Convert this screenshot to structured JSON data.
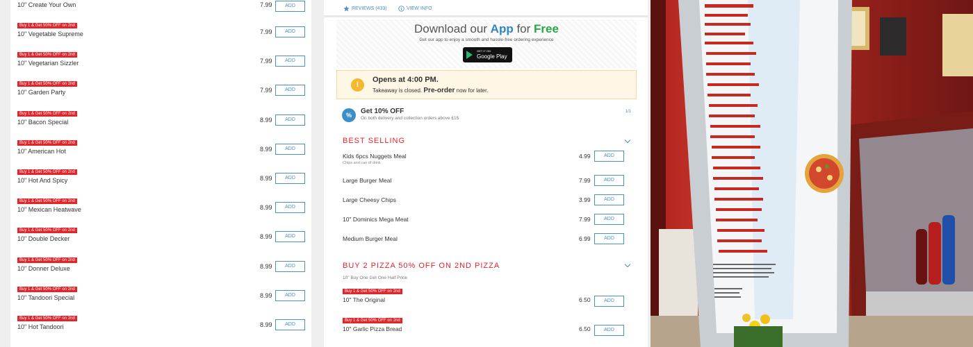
{
  "left_menu": {
    "badge_text": "Buy 1 & Get 50% OFF on 2nd",
    "add_label": "ADD",
    "items": [
      {
        "name": "10\" Create Your Own",
        "price": "7.99",
        "badge": false
      },
      {
        "name": "10\" Vegetable Supreme",
        "price": "7.99",
        "badge": true
      },
      {
        "name": "10\" Vegetarian Sizzler",
        "price": "7.99",
        "badge": true
      },
      {
        "name": "10\" Garden Party",
        "price": "7.99",
        "badge": true
      },
      {
        "name": "10\" Bacon Special",
        "price": "8.99",
        "badge": true
      },
      {
        "name": "10\" American Hot",
        "price": "8.99",
        "badge": true
      },
      {
        "name": "10\" Hot And Spicy",
        "price": "8.99",
        "badge": true
      },
      {
        "name": "10\" Mexican Heatwave",
        "price": "8.99",
        "badge": true
      },
      {
        "name": "10\" Double Decker",
        "price": "8.99",
        "badge": true
      },
      {
        "name": "10\" Donner Deluxe",
        "price": "8.99",
        "badge": true
      },
      {
        "name": "10\" Tandoori Special",
        "price": "8.99",
        "badge": true
      },
      {
        "name": "10\" Hot Tandoori",
        "price": "8.99",
        "badge": true
      }
    ]
  },
  "top_links": {
    "reviews": "REVIEWS (433)",
    "view_info": "VIEW INFO"
  },
  "app_banner": {
    "title_pre": "Download our",
    "title_app": "App",
    "title_mid": "for",
    "title_free": "Free",
    "subtitle": "Get our app to enjoy a smooth and hassle-free ordering experience",
    "store_small": "GET IT ON",
    "store_big": "Google Play"
  },
  "open_notice": {
    "title": "Opens at 4:00 PM.",
    "text_pre": "Takeaway is closed.",
    "text_bold": "Pre-order",
    "text_post": "now for later."
  },
  "discount": {
    "icon": "%",
    "title": "Get 10% OFF",
    "subtitle": "On both delivery and collection orders above £15",
    "page": "1/1"
  },
  "best_selling": {
    "title": "BEST SELLING",
    "items": [
      {
        "name": "Kids 6pcs Nuggets Meal",
        "sub": "Chips and can of drink",
        "price": "4.99"
      },
      {
        "name": "Large Burger Meal",
        "sub": "",
        "price": "7.99"
      },
      {
        "name": "Large Cheesy Chips",
        "sub": "",
        "price": "3.99"
      },
      {
        "name": "10\" Dominics Mega Meat",
        "sub": "",
        "price": "7.99"
      },
      {
        "name": "Medium Burger Meal",
        "sub": "",
        "price": "6.99"
      }
    ]
  },
  "pizza_offer": {
    "title": "BUY 2 PIZZA 50% OFF ON 2ND PIZZA",
    "note": "10\" Buy One Get One Half Price",
    "items": [
      {
        "name": "10\" The Original",
        "price": "6.50"
      },
      {
        "name": "10\" Garlic Pizza Bread",
        "price": "6.50"
      }
    ]
  },
  "colors": {
    "accent_red": "#e3242b",
    "link_blue": "#4a90c2"
  }
}
